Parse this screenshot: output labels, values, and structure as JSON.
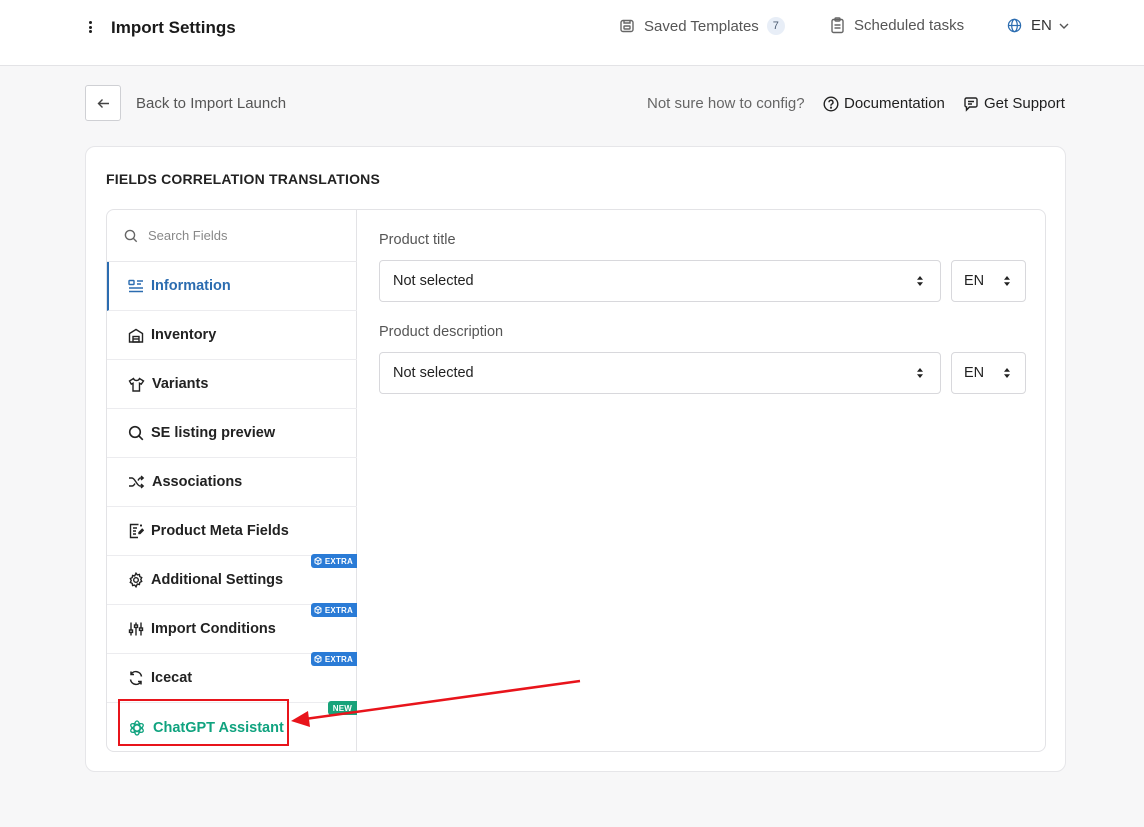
{
  "header": {
    "title": "Import Settings",
    "saved_templates_label": "Saved Templates",
    "saved_templates_count": "7",
    "scheduled_tasks_label": "Scheduled tasks",
    "language": "EN"
  },
  "toolbar": {
    "back_label": "Back to Import Launch",
    "help_text": "Not sure how to config?",
    "documentation_label": "Documentation",
    "support_label": "Get Support"
  },
  "section": {
    "title": "FIELDS CORRELATION TRANSLATIONS"
  },
  "sidebar": {
    "search_placeholder": "Search Fields",
    "items": [
      {
        "label": "Information",
        "icon": "list-details-icon",
        "active": true
      },
      {
        "label": "Inventory",
        "icon": "warehouse-icon"
      },
      {
        "label": "Variants",
        "icon": "shirt-icon"
      },
      {
        "label": "SE listing preview",
        "icon": "search-icon"
      },
      {
        "label": "Associations",
        "icon": "shuffle-icon"
      },
      {
        "label": "Product Meta Fields",
        "icon": "document-edit-icon"
      },
      {
        "label": "Additional Settings",
        "icon": "gear-icon",
        "tag": "EXTRA"
      },
      {
        "label": "Import Conditions",
        "icon": "sliders-icon",
        "tag": "EXTRA"
      },
      {
        "label": "Icecat",
        "icon": "refresh-icon",
        "tag": "EXTRA"
      },
      {
        "label": "ChatGPT Assistant",
        "icon": "openai-icon",
        "tag": "NEW"
      }
    ]
  },
  "fields": [
    {
      "label": "Product title",
      "value": "Not selected",
      "lang": "EN"
    },
    {
      "label": "Product description",
      "value": "Not selected",
      "lang": "EN"
    }
  ],
  "colors": {
    "accent": "#2b6cb0",
    "extra_tag": "#2a7bd6",
    "new_tag": "#18a37a",
    "chatgpt": "#10a37f",
    "annotation": "#e8141b"
  }
}
